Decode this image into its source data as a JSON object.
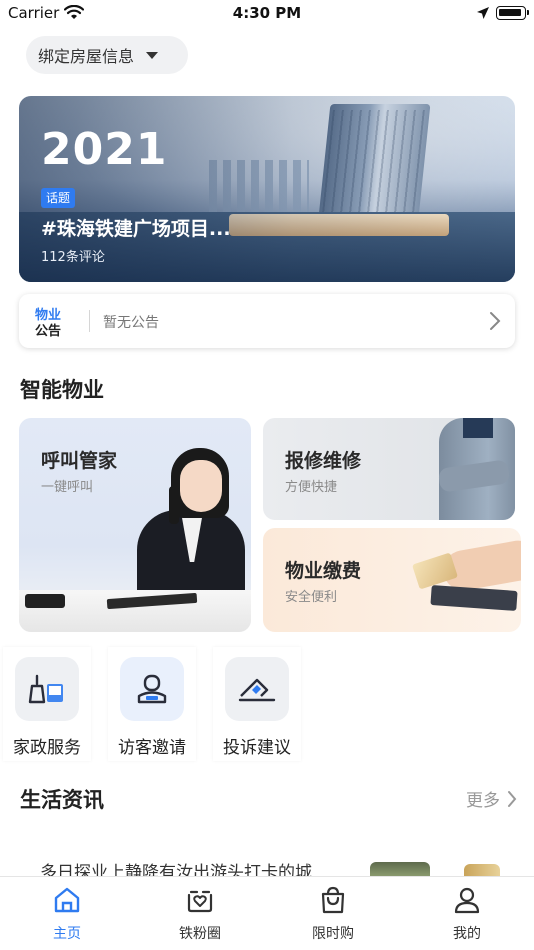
{
  "status_bar": {
    "carrier": "Carrier",
    "time": "4:30 PM"
  },
  "header": {
    "bind_house_label": "绑定房屋信息"
  },
  "banner": {
    "year": "2021",
    "tag": "话题",
    "topic": "#珠海铁建广场项目...",
    "comments": "112条评论"
  },
  "notice": {
    "label_line1": "物业",
    "label_line2": "公告",
    "message": "暂无公告"
  },
  "smart_property": {
    "title": "智能物业",
    "cards": [
      {
        "title": "呼叫管家",
        "subtitle": "一键呼叫"
      },
      {
        "title": "报修维修",
        "subtitle": "方便快捷"
      },
      {
        "title": "物业缴费",
        "subtitle": "安全便利"
      }
    ],
    "quick_actions": [
      {
        "label": "家政服务",
        "icon": "housekeeping-icon"
      },
      {
        "label": "访客邀请",
        "icon": "visitor-icon"
      },
      {
        "label": "投诉建议",
        "icon": "complaint-icon"
      }
    ]
  },
  "life_news": {
    "title": "生活资讯",
    "more_label": "更多",
    "first_item_partial": "多日探业上静降有汝出游头打卡的城"
  },
  "tabbar": {
    "active_color": "#2f7bf0",
    "items": [
      {
        "label": "主页",
        "icon": "home-icon",
        "active": true
      },
      {
        "label": "铁粉圈",
        "icon": "fans-circle-icon",
        "active": false
      },
      {
        "label": "限时购",
        "icon": "shopping-bag-icon",
        "active": false
      },
      {
        "label": "我的",
        "icon": "profile-icon",
        "active": false
      }
    ]
  }
}
